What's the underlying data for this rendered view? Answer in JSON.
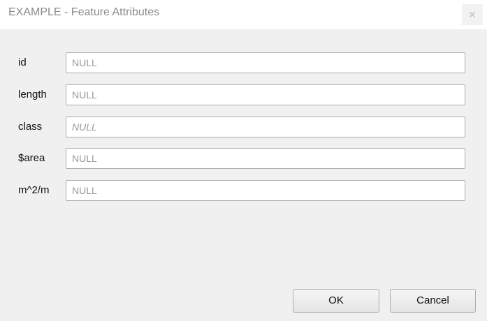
{
  "window": {
    "title": "EXAMPLE - Feature Attributes",
    "close_glyph": "✕"
  },
  "fields": [
    {
      "label": "id",
      "value": "",
      "placeholder": "NULL",
      "italic": false
    },
    {
      "label": "length",
      "value": "",
      "placeholder": "NULL",
      "italic": false
    },
    {
      "label": "class",
      "value": "",
      "placeholder": "NULL",
      "italic": true
    },
    {
      "label": "$area",
      "value": "",
      "placeholder": "NULL",
      "italic": false
    },
    {
      "label": "m^2/m",
      "value": "",
      "placeholder": "NULL",
      "italic": false
    }
  ],
  "buttons": {
    "ok_label": "OK",
    "cancel_label": "Cancel"
  },
  "icons": {
    "close": "close-icon"
  }
}
